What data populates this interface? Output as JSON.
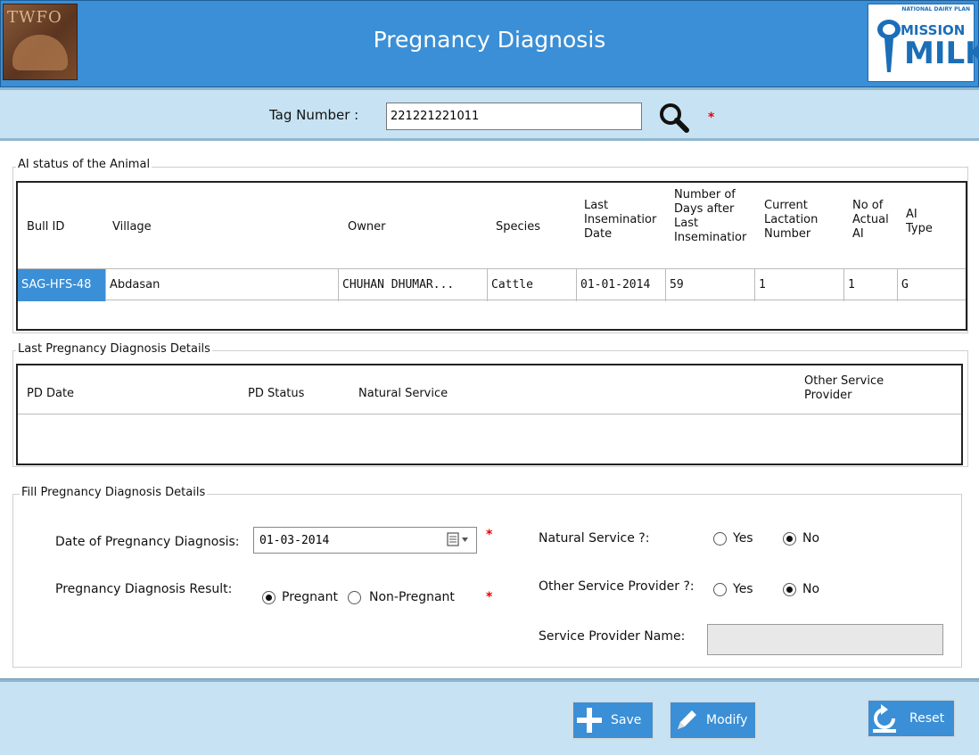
{
  "header": {
    "title": "Pregnancy Diagnosis",
    "logo_left_text": "TWFO",
    "logo_right": {
      "tagline": "NATIONAL DAIRY PLAN",
      "line1": "MISSION",
      "line2": "MILK"
    },
    "bg_color": "#3a8fd6"
  },
  "tag": {
    "label": "Tag Number :",
    "value": "221221221011",
    "required_mark": "*",
    "search_icon": "search-icon"
  },
  "ai_status": {
    "legend": "AI status of the Animal",
    "columns": [
      "Bull ID",
      "Village",
      "Owner",
      "Species",
      "Last Insemination Date",
      "Number of Days after Last Insemination",
      "Current Lactation Number",
      "No of Actual AI",
      "AI Type"
    ],
    "column_lines": [
      [
        "Bull ID"
      ],
      [
        "Village"
      ],
      [
        "Owner"
      ],
      [
        "Species"
      ],
      [
        "Last",
        "Inseminatior",
        "Date"
      ],
      [
        "Number of",
        "Days after",
        "Last",
        "Inseminatior"
      ],
      [
        "Current",
        "Lactation",
        "Number"
      ],
      [
        "No of",
        "Actual",
        "AI"
      ],
      [
        "AI",
        "Type"
      ]
    ],
    "rows": [
      [
        "SAG-HFS-48",
        "Abdasan",
        "CHUHAN  DHUMAR...",
        "Cattle",
        "01-01-2014",
        "59",
        "1",
        "1",
        "G"
      ]
    ],
    "selected_cell_color": "#3a8fd6"
  },
  "last_pd": {
    "legend": "Last Pregnancy Diagnosis Details",
    "columns": [
      "PD Date",
      "PD Status",
      "Natural Service",
      "Other Service Provider"
    ],
    "column_lines": [
      [
        "PD Date"
      ],
      [
        "PD Status"
      ],
      [
        "Natural Service"
      ],
      [
        "Other Service",
        "Provider"
      ]
    ],
    "rows": []
  },
  "fill_pd": {
    "legend": "Fill Pregnancy Diagnosis Details",
    "date_label": "Date of Pregnancy Diagnosis:",
    "date_value": "01-03-2014",
    "result_label": "Pregnancy Diagnosis Result:",
    "result_options": [
      "Pregnant",
      "Non-Pregnant"
    ],
    "result_selected": "Pregnant",
    "natural_label": "Natural Service ?:",
    "natural_options": [
      "Yes",
      "No"
    ],
    "natural_selected": "No",
    "other_label": "Other Service Provider ?:",
    "other_options": [
      "Yes",
      "No"
    ],
    "other_selected": "No",
    "sp_name_label": "Service Provider Name:",
    "sp_name_value": "",
    "required_mark": "*"
  },
  "footer": {
    "save_label": "Save",
    "modify_label": "Modify",
    "reset_label": "Reset",
    "bg_color": "#c7e3f3"
  }
}
